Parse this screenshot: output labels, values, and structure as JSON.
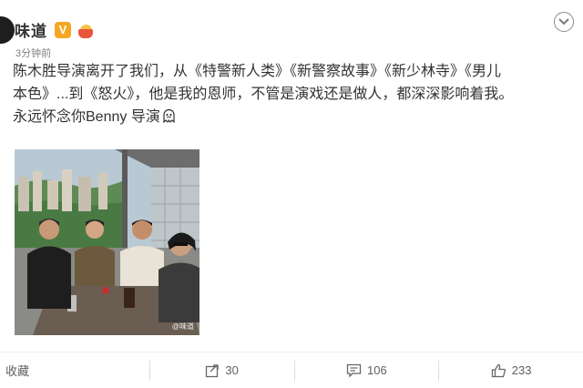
{
  "post": {
    "username": "味道",
    "verified_badge": "V",
    "time": "3分钟前",
    "text_lines": [
      "陈木胜导演离开了我们，从《特警新人类》《新警察故事》《新少林寺》《男儿",
      "本色》...到《怒火》，他是我的恩师，不管是演戏还是做人，都深深影响着我。",
      "永远怀念你Benny 导演"
    ],
    "image_watermark": "@味道"
  },
  "actions": {
    "favorite_label": "收藏",
    "repost_count": "30",
    "comment_count": "106",
    "like_count": "233"
  },
  "icons": {
    "menu": "chevron-down-icon",
    "repost": "share-icon",
    "comment": "comment-icon",
    "like": "thumbs-up-icon",
    "emoji": "crying-face-emoji"
  },
  "colors": {
    "verified": "#f5a623",
    "text": "#333333",
    "meta": "#808080"
  }
}
